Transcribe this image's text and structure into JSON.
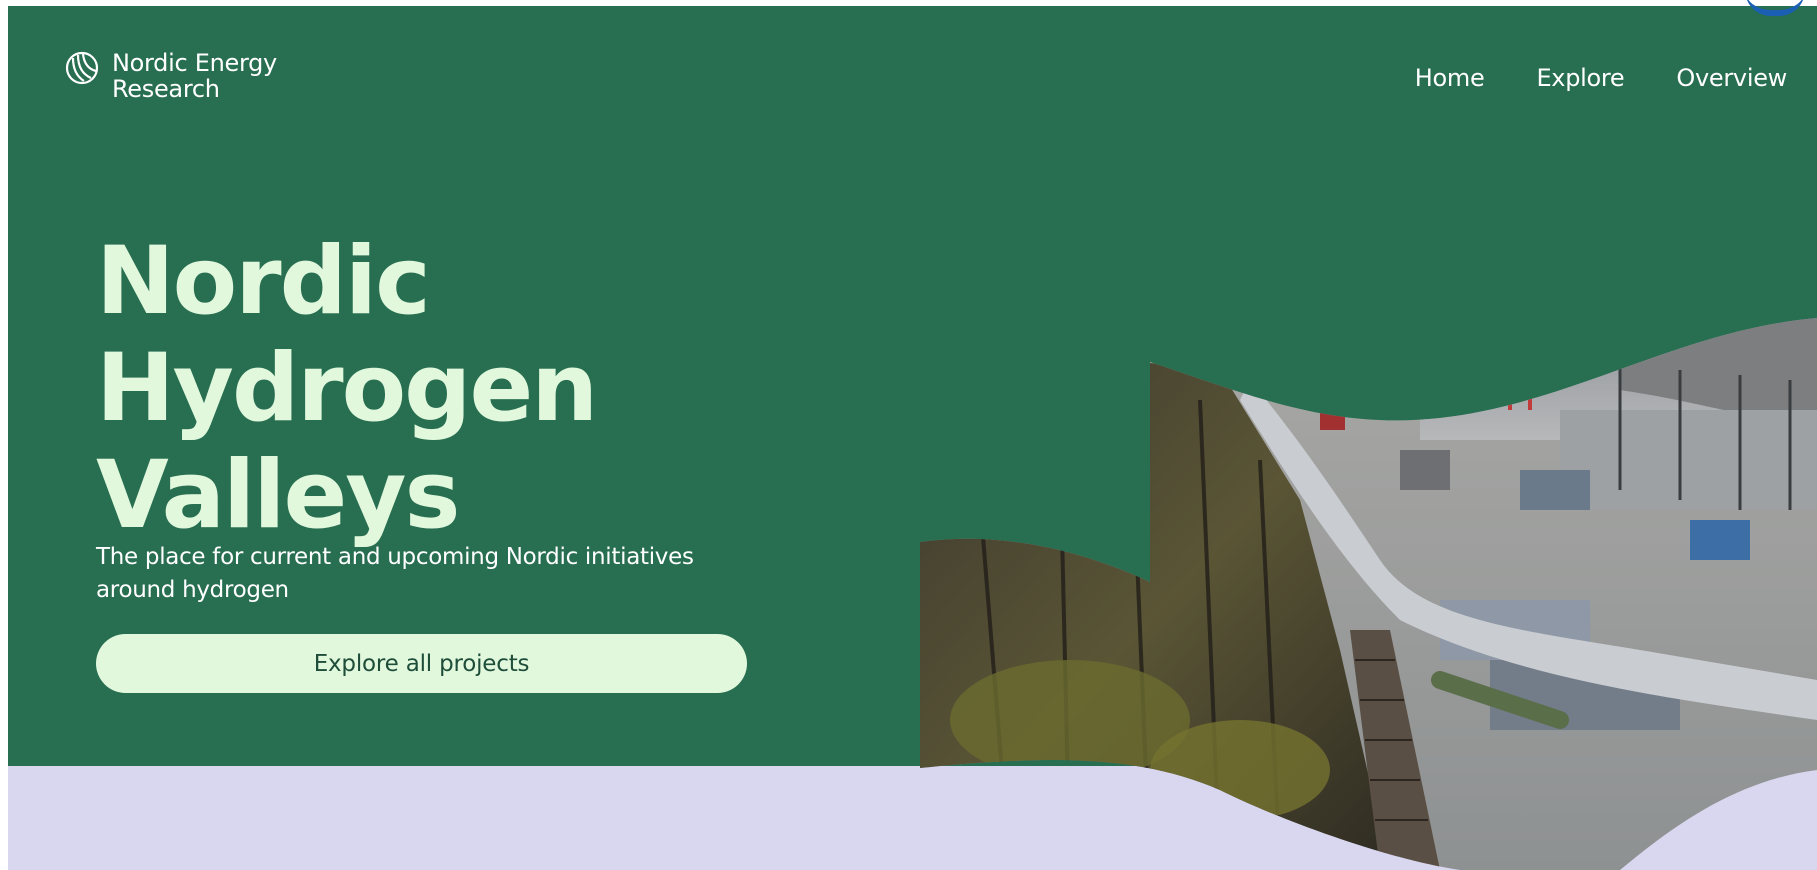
{
  "header": {
    "logo_line1": "Nordic Energy",
    "logo_line2": "Research",
    "nav": [
      {
        "label": "Home"
      },
      {
        "label": "Explore"
      },
      {
        "label": "Overview"
      }
    ]
  },
  "hero": {
    "title_line1": "Nordic",
    "title_line2": "Hydrogen",
    "title_line3": "Valleys",
    "subtitle": "The place for current and upcoming Nordic initiatives around hydrogen",
    "cta_label": "Explore all projects"
  },
  "colors": {
    "hero_bg": "#286e51",
    "title": "#e1f8dd",
    "cta_bg": "#e1f8dd",
    "lower_section": "#d8d7ef"
  },
  "icons": {
    "logo": "nordic-swan-icon",
    "corner": "partial-accent-icon"
  }
}
